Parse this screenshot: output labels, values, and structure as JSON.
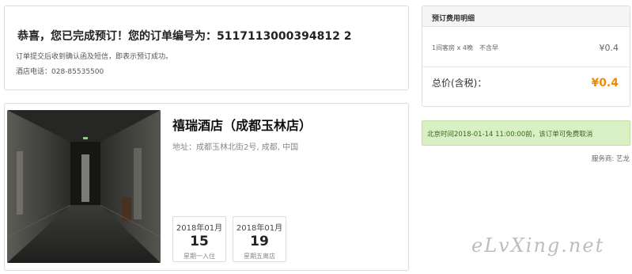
{
  "confirmation": {
    "title": "恭喜，您已完成预订！您的订单编号为：5117113000394812 2",
    "note": "订单提交后收到确认函及短信，即表示预订成功。",
    "phone": "酒店电话：028-85535500"
  },
  "hotel": {
    "name": "禧瑞酒店（成都玉林店）",
    "address": "地址：成都玉林北街2号, 成都, 中国",
    "checkin": {
      "year_month": "2018年01月",
      "day": "15",
      "weekday": "星期一入住"
    },
    "checkout": {
      "year_month": "2018年01月",
      "day": "19",
      "weekday": "星期五离店"
    }
  },
  "price": {
    "header": "预订费用明细",
    "line_desc": "1间客房 x 4晚　不含早",
    "line_amount": "¥0.4",
    "total_label": "总价(含税)：",
    "total_amount": "¥0.4",
    "accent_color": "#f08c00"
  },
  "cancel_notice": "北京时间2018-01-14 11:00:00前，该订单可免费取消",
  "provider": "服务商: 艺龙",
  "watermark": "eLvXing.net"
}
